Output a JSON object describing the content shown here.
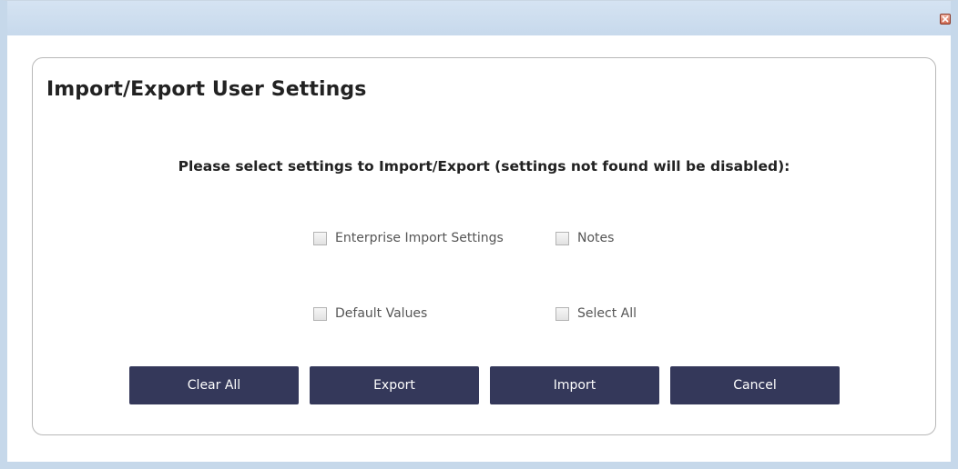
{
  "dialog": {
    "title": "Import/Export User Settings",
    "instructions": "Please select settings to Import/Export (settings not found will be disabled):"
  },
  "options": [
    {
      "label": "Enterprise Import Settings",
      "checked": false,
      "disabled": true
    },
    {
      "label": "Notes",
      "checked": false,
      "disabled": true
    },
    {
      "label": "Default Values",
      "checked": false,
      "disabled": true
    },
    {
      "label": "Select All",
      "checked": false,
      "disabled": true
    }
  ],
  "buttons": {
    "clear_all": "Clear All",
    "export": "Export",
    "import": "Import",
    "cancel": "Cancel"
  },
  "window": {
    "close_icon": "close-icon",
    "frame_color": "#c6d8ea",
    "button_color": "#34385a"
  }
}
